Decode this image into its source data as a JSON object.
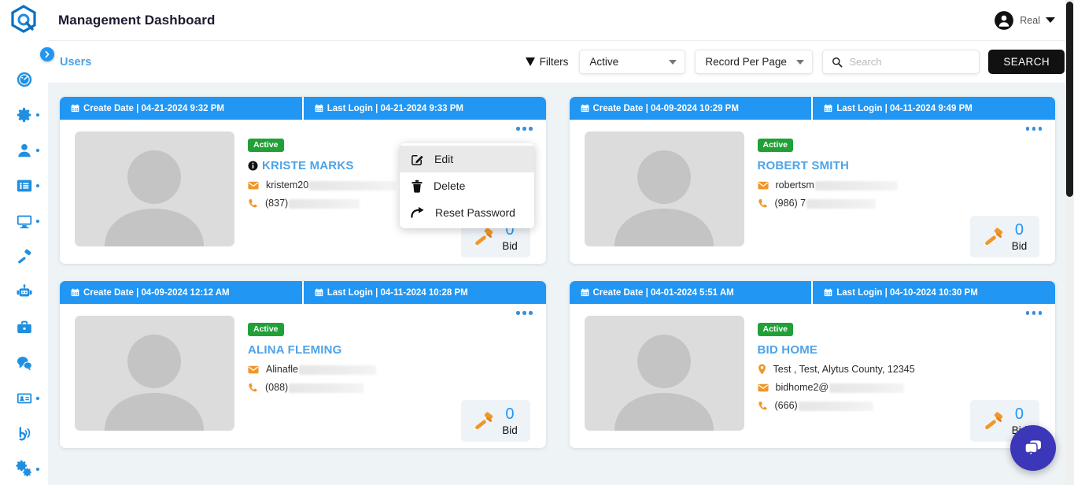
{
  "header": {
    "title": "Management Dashboard",
    "user_name": "Real",
    "logo_name": "app-logo"
  },
  "sidebar": {
    "items": [
      {
        "icon": "dashboard-speedometer-icon",
        "has_dot": false
      },
      {
        "icon": "gear-icon",
        "has_dot": true
      },
      {
        "icon": "user-icon",
        "has_dot": true
      },
      {
        "icon": "list-icon",
        "has_dot": true
      },
      {
        "icon": "monitor-icon",
        "has_dot": true
      },
      {
        "icon": "hammer-icon",
        "has_dot": false
      },
      {
        "icon": "robot-icon",
        "has_dot": false
      },
      {
        "icon": "briefcase-icon",
        "has_dot": false
      },
      {
        "icon": "chat-bubbles-icon",
        "has_dot": false
      },
      {
        "icon": "id-card-icon",
        "has_dot": true
      },
      {
        "icon": "broadcast-icon",
        "has_dot": false
      },
      {
        "icon": "gears-settings-icon",
        "has_dot": true
      }
    ],
    "expand_label": "expand-sidebar"
  },
  "toolbar": {
    "breadcrumb": "Users",
    "filters_label": "Filters",
    "status_select": "Active",
    "records_select": "Record Per Page",
    "search_placeholder": "Search",
    "search_value": "",
    "search_button": "SEARCH"
  },
  "context_menu": {
    "visible": true,
    "items": [
      {
        "label": "Edit",
        "icon": "edit-pencil-icon",
        "hovered": true
      },
      {
        "label": "Delete",
        "icon": "trash-icon",
        "hovered": false
      },
      {
        "label": "Reset Password",
        "icon": "reset-arrow-icon",
        "hovered": false
      }
    ]
  },
  "labels": {
    "create_date": "Create Date",
    "last_login": "Last Login",
    "separator": "|",
    "bid_label": "Bid",
    "status_active": "Active"
  },
  "cards": [
    {
      "create_date": "Create Date | 04-21-2024 9:32 PM",
      "last_login": "Last Login | 04-21-2024 9:33 PM",
      "status": "Active",
      "name": "KRISTE MARKS",
      "has_info_icon": true,
      "address": null,
      "email": "kristem20",
      "email_redacted_width": 110,
      "phone": "(837)",
      "phone_redacted_width": 90,
      "bid_count": "0",
      "bid_label": "Bid"
    },
    {
      "create_date": "Create Date | 04-09-2024 10:29 PM",
      "last_login": "Last Login | 04-11-2024 9:49 PM",
      "status": "Active",
      "name": "ROBERT SMITH",
      "has_info_icon": false,
      "address": null,
      "email": "robertsm",
      "email_redacted_width": 105,
      "phone": "(986) 7",
      "phone_redacted_width": 88,
      "bid_count": "0",
      "bid_label": "Bid"
    },
    {
      "create_date": "Create Date | 04-09-2024 12:12 AM",
      "last_login": "Last Login | 04-11-2024 10:28 PM",
      "status": "Active",
      "name": "ALINA FLEMING",
      "has_info_icon": false,
      "address": null,
      "email": "Alinafle",
      "email_redacted_width": 98,
      "phone": "(088)",
      "phone_redacted_width": 95,
      "bid_count": "0",
      "bid_label": "Bid"
    },
    {
      "create_date": "Create Date | 04-01-2024 5:51 AM",
      "last_login": "Last Login | 04-10-2024 10:30 PM",
      "status": "Active",
      "name": "BID HOME",
      "has_info_icon": false,
      "address": "Test , Test, Alytus County, 12345",
      "email": "bidhome2@",
      "email_redacted_width": 95,
      "phone": "(666)",
      "phone_redacted_width": 95,
      "bid_count": "0",
      "bid_label": "Bid"
    }
  ],
  "chat_widget": {
    "icon": "chat-bubbles-icon"
  },
  "colors": {
    "accent_blue": "#2196f3",
    "link_blue": "#4da3e8",
    "active_green": "#21a038",
    "gavel_orange": "#f0972a",
    "chat_indigo": "#3b37b8",
    "page_bg": "#eef3f6"
  }
}
